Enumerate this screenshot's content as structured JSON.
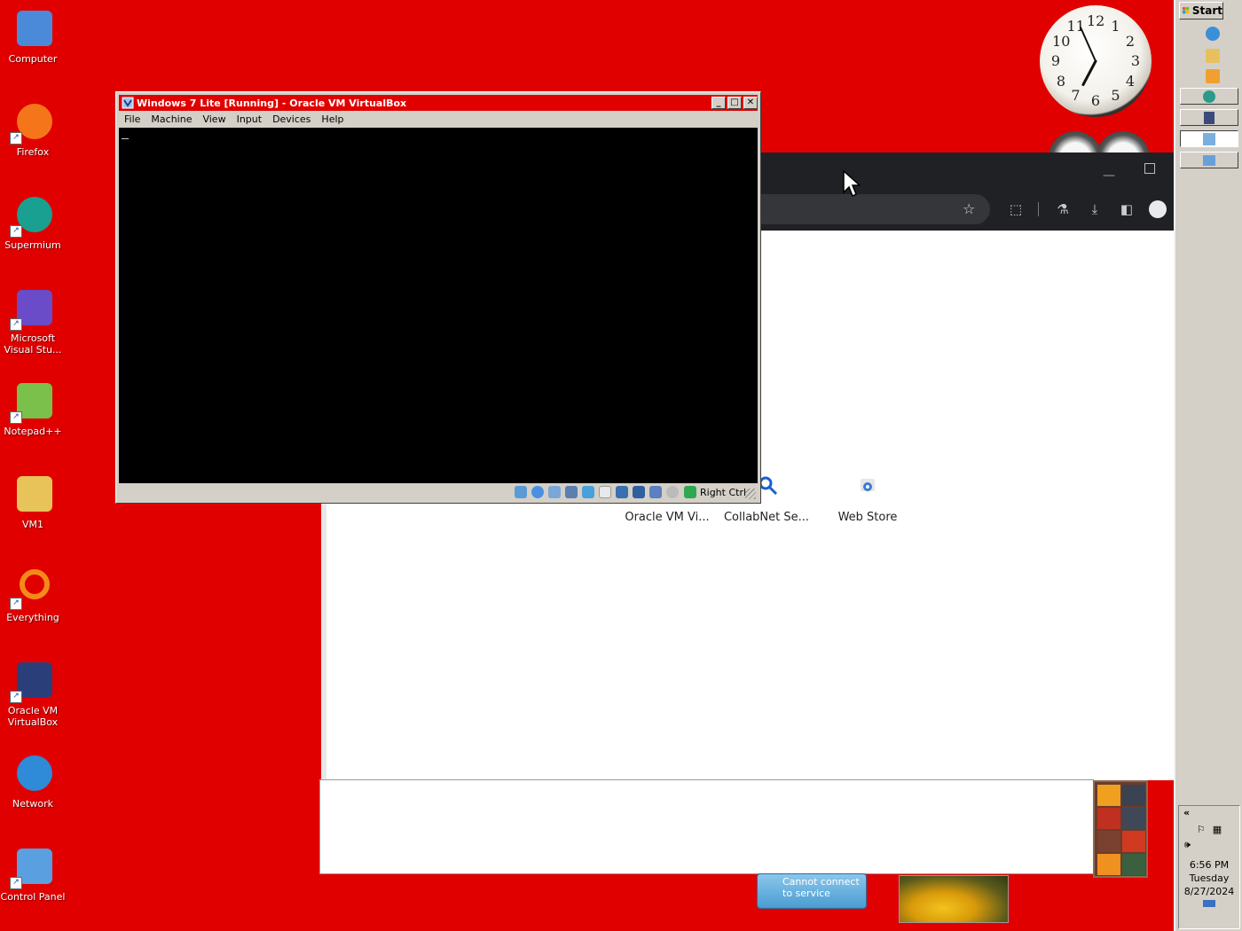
{
  "desktop": {
    "icons": [
      {
        "label": "Computer",
        "icon": "computer-icon"
      },
      {
        "label": "Firefox",
        "icon": "firefox-icon"
      },
      {
        "label": "Supermium",
        "icon": "supermium-icon"
      },
      {
        "label": "Microsoft Visual Stu...",
        "icon": "visual-studio-icon"
      },
      {
        "label": "Notepad++",
        "icon": "notepad-plus-plus-icon"
      },
      {
        "label": "VM1",
        "icon": "folder-icon"
      },
      {
        "label": "Everything",
        "icon": "everything-icon"
      },
      {
        "label": "Oracle VM VirtualBox",
        "icon": "virtualbox-icon"
      },
      {
        "label": "Network",
        "icon": "network-icon"
      },
      {
        "label": "Control Panel",
        "icon": "control-panel-icon"
      }
    ]
  },
  "vbox": {
    "title": "Windows 7 Lite [Running] - Oracle VM VirtualBox",
    "menu": [
      "File",
      "Machine",
      "View",
      "Input",
      "Devices",
      "Help"
    ],
    "host_key": "Right Ctrl"
  },
  "browser": {
    "shortcuts": [
      "Oracle VM Vi...",
      "CollabNet Se...",
      "Web Store"
    ]
  },
  "weather": {
    "text": "Cannot connect to service"
  },
  "clock": {
    "numbers": [
      "12",
      "1",
      "2",
      "3",
      "4",
      "5",
      "6",
      "7",
      "8",
      "9",
      "10",
      "11"
    ],
    "hour": 6.93,
    "minute": 56
  },
  "taskbar": {
    "start_label": "Start",
    "tray_expand": "«",
    "time": "6:56 PM",
    "day": "Tuesday",
    "date": "8/27/2024"
  },
  "colors": {
    "desktop": "#e00000",
    "titlebar": "#e00000",
    "taskbar": "#d4d0c8"
  }
}
